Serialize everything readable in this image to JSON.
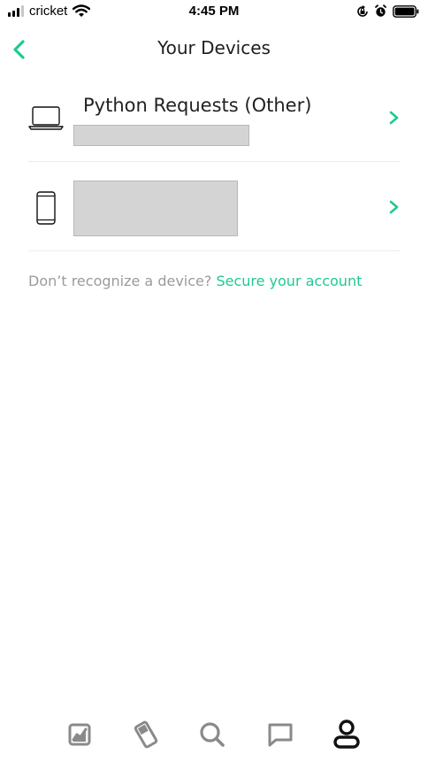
{
  "status_bar": {
    "carrier": "cricket",
    "time": "4:45 PM",
    "icons": [
      "signal-icon",
      "wifi-icon",
      "orientation-lock-icon",
      "alarm-icon",
      "battery-icon"
    ]
  },
  "header": {
    "title": "Your Devices",
    "back_icon": "chevron-left-icon"
  },
  "devices": [
    {
      "name": "Python Requests (Other)",
      "icon": "laptop-icon",
      "detail_redacted": true
    },
    {
      "name": "",
      "icon": "phone-icon",
      "detail_redacted": true
    }
  ],
  "help": {
    "text": "Don’t recognize a device? ",
    "link": "Secure your account"
  },
  "tab_bar": {
    "tabs": [
      "portfolio-icon",
      "cards-icon",
      "search-icon",
      "messages-icon",
      "account-icon"
    ],
    "active_index": 4
  },
  "colors": {
    "accent": "#21c895",
    "text_primary": "#1f1f1f",
    "text_secondary": "#9b9b9b",
    "tab_inactive": "#8a8a8a",
    "tab_active": "#111111",
    "redaction": "#d4d4d4"
  }
}
